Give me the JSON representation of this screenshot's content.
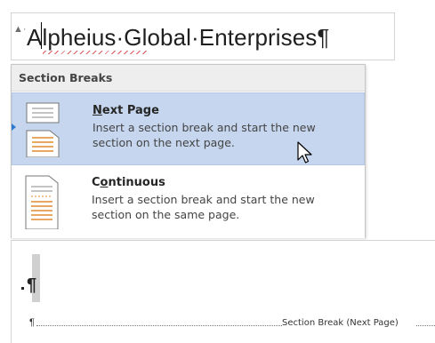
{
  "document": {
    "heading_text": "Alpheius·Global·Enterprises¶",
    "paragraph_mark_small": "▲·",
    "empty_paragraph_mark": "¶",
    "break_pilcrow": "¶",
    "section_break_label": "Section Break (Next Page)"
  },
  "menu": {
    "header": "Section Breaks",
    "items": [
      {
        "title_accel": "N",
        "title_rest": "ext Page",
        "description": "Insert a section break and start the new section on the next page.",
        "icon": "next-page-icon"
      },
      {
        "title_pre": "C",
        "title_accel": "o",
        "title_rest": "ntinuous",
        "description": "Insert a section break and start the new section on the same page.",
        "icon": "continuous-icon"
      }
    ]
  },
  "colors": {
    "selected_item": "#c5d6ee",
    "header_bg": "#eeeeee",
    "accent_arrow": "#2b79d0"
  }
}
